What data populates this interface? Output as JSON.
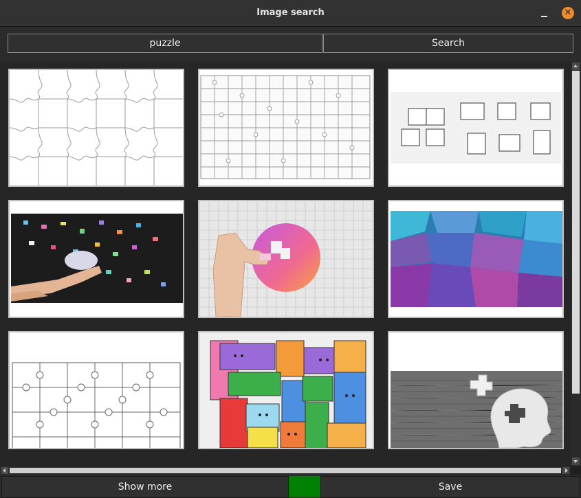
{
  "window": {
    "title": "Image search",
    "minimize_icon": "minimize-icon",
    "close_icon": "close-icon"
  },
  "search": {
    "query": "puzzle",
    "button_label": "Search"
  },
  "results": [
    {
      "kind": "outline-jigsaw-grid"
    },
    {
      "kind": "outline-jigsaw-grid-fine"
    },
    {
      "kind": "separated-pieces-outline"
    },
    {
      "kind": "photo-hands-scattered-pieces"
    },
    {
      "kind": "photo-hand-pink-circle-puzzle"
    },
    {
      "kind": "photo-colorful-pieces-pile"
    },
    {
      "kind": "outline-jigsaw-grid-large"
    },
    {
      "kind": "illustration-colorful-block-puzzle"
    },
    {
      "kind": "photo-paper-head-piece"
    }
  ],
  "footer": {
    "show_more_label": "Show more",
    "save_label": "Save",
    "status_color": "#008000"
  },
  "colors": {
    "window_bg": "#1f1f1f",
    "accent_close": "#f08a2c",
    "thumb_border": "#c0c0c0"
  }
}
